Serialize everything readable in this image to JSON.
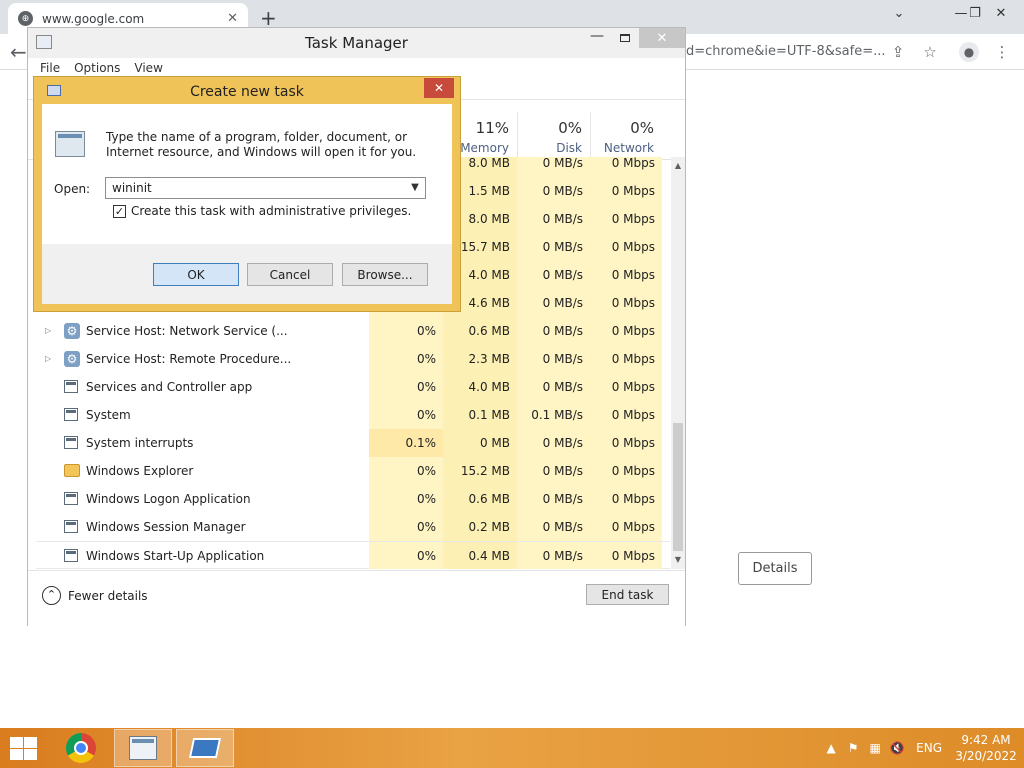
{
  "browser": {
    "tab_title": "www.google.com",
    "tab_close": "✕",
    "new_tab": "+",
    "omnibox_tail": "d=chrome&ie=UTF-8&safe=...",
    "details_button": "Details"
  },
  "task_manager": {
    "title": "Task Manager",
    "menu": [
      "File",
      "Options",
      "View"
    ],
    "columns": [
      {
        "percent": "11%",
        "name": "Memory"
      },
      {
        "percent": "0%",
        "name": "Disk"
      },
      {
        "percent": "0%",
        "name": "Network"
      }
    ],
    "hidden_rows": [
      {
        "cpu": "",
        "mem": "8.0 MB",
        "disk": "0 MB/s",
        "net": "0 Mbps"
      },
      {
        "cpu": "",
        "mem": "1.5 MB",
        "disk": "0 MB/s",
        "net": "0 Mbps"
      },
      {
        "cpu": "",
        "mem": "8.0 MB",
        "disk": "0 MB/s",
        "net": "0 Mbps"
      },
      {
        "cpu": "",
        "mem": "15.7 MB",
        "disk": "0 MB/s",
        "net": "0 Mbps"
      },
      {
        "cpu": "",
        "mem": "4.0 MB",
        "disk": "0 MB/s",
        "net": "0 Mbps"
      },
      {
        "cpu": "",
        "mem": "4.6 MB",
        "disk": "0 MB/s",
        "net": "0 Mbps"
      }
    ],
    "rows": [
      {
        "name": "Service Host: Network Service (...",
        "icon": "gear",
        "expandable": true,
        "cpu": "0%",
        "mem": "0.6 MB",
        "disk": "0 MB/s",
        "net": "0 Mbps"
      },
      {
        "name": "Service Host: Remote Procedure...",
        "icon": "gear",
        "expandable": true,
        "cpu": "0%",
        "mem": "2.3 MB",
        "disk": "0 MB/s",
        "net": "0 Mbps"
      },
      {
        "name": "Services and Controller app",
        "icon": "window",
        "expandable": false,
        "cpu": "0%",
        "mem": "4.0 MB",
        "disk": "0 MB/s",
        "net": "0 Mbps"
      },
      {
        "name": "System",
        "icon": "window",
        "expandable": false,
        "cpu": "0%",
        "mem": "0.1 MB",
        "disk": "0.1 MB/s",
        "net": "0 Mbps"
      },
      {
        "name": "System interrupts",
        "icon": "window",
        "expandable": false,
        "cpu": "0.1%",
        "mem": "0 MB",
        "disk": "0 MB/s",
        "net": "0 Mbps"
      },
      {
        "name": "Windows Explorer",
        "icon": "folder",
        "expandable": false,
        "cpu": "0%",
        "mem": "15.2 MB",
        "disk": "0 MB/s",
        "net": "0 Mbps"
      },
      {
        "name": "Windows Logon Application",
        "icon": "window",
        "expandable": false,
        "cpu": "0%",
        "mem": "0.6 MB",
        "disk": "0 MB/s",
        "net": "0 Mbps"
      },
      {
        "name": "Windows Session Manager",
        "icon": "window",
        "expandable": false,
        "cpu": "0%",
        "mem": "0.2 MB",
        "disk": "0 MB/s",
        "net": "0 Mbps"
      },
      {
        "name": "Windows Start-Up Application",
        "icon": "window",
        "expandable": false,
        "cpu": "0%",
        "mem": "0.4 MB",
        "disk": "0 MB/s",
        "net": "0 Mbps"
      }
    ],
    "fewer_details": "Fewer details",
    "end_task": "End task"
  },
  "dialog": {
    "title": "Create new task",
    "message": "Type the name of a program, folder, document, or Internet resource, and Windows will open it for you.",
    "open_label": "Open:",
    "open_value": "wininit",
    "admin_checkbox_label": "Create this task with administrative privileges.",
    "admin_checked": true,
    "ok": "OK",
    "cancel": "Cancel",
    "browse": "Browse..."
  },
  "taskbar": {
    "language": "ENG",
    "time": "9:42 AM",
    "date": "3/20/2022"
  }
}
